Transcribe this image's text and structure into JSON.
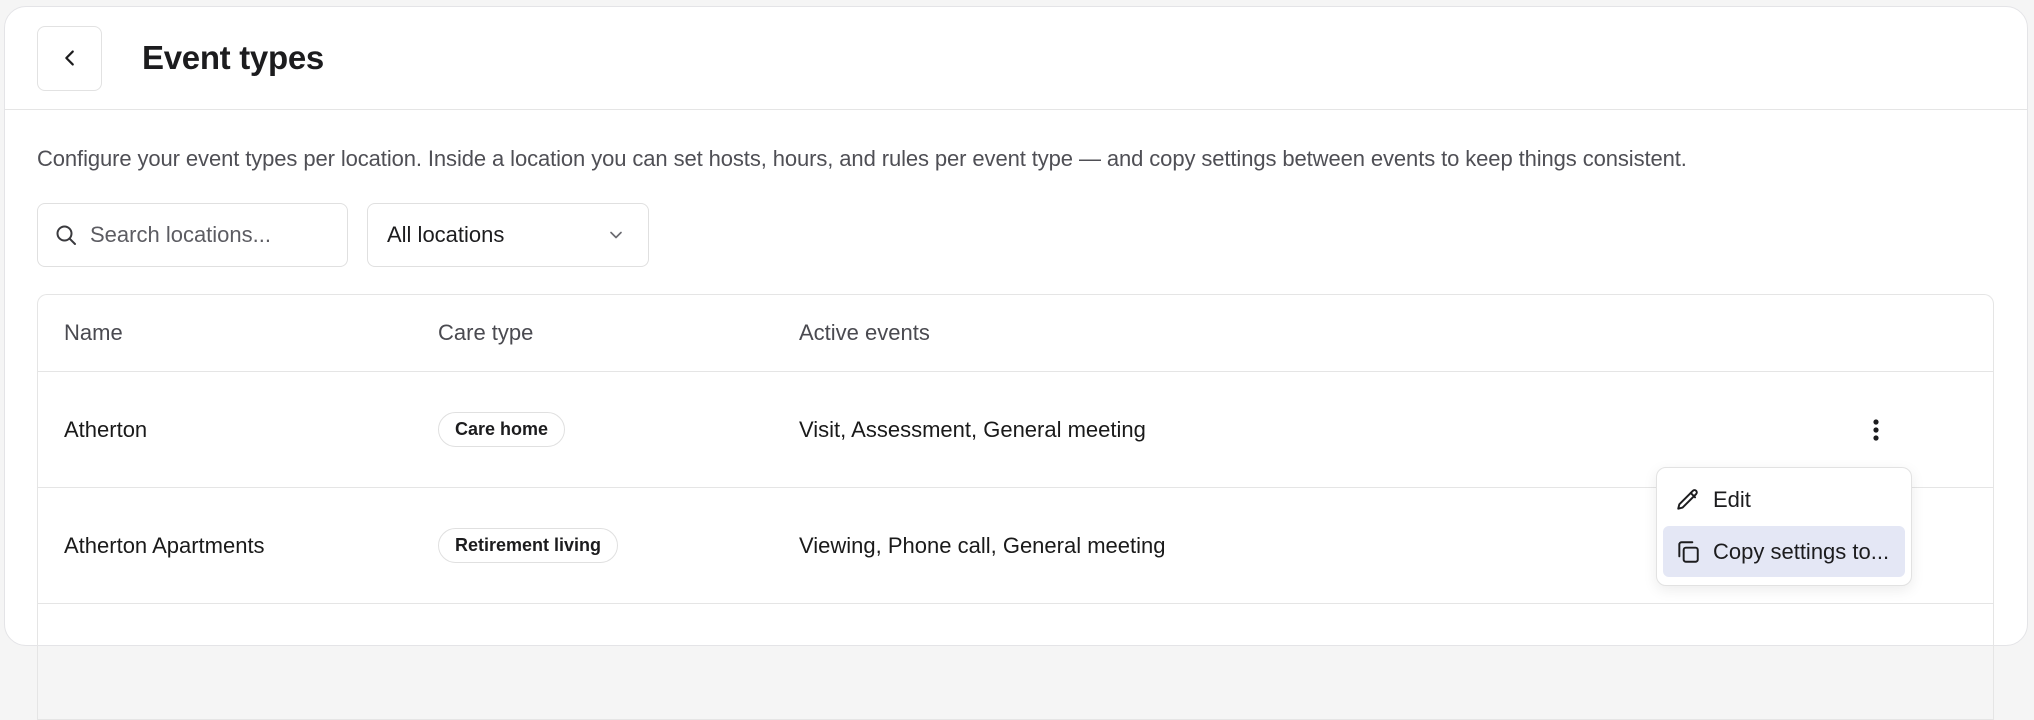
{
  "header": {
    "title": "Event types",
    "back_icon": "chevron-left-icon"
  },
  "description": "Configure your event types per location. Inside a location you can set hosts, hours, and rules per event type — and copy settings between events to keep things consistent.",
  "filters": {
    "search_placeholder": "Search locations...",
    "search_value": "",
    "location_select": "All locations"
  },
  "table": {
    "columns": [
      "Name",
      "Care type",
      "Active events"
    ],
    "rows": [
      {
        "name": "Atherton",
        "care_type": "Care home",
        "events": "Visit, Assessment, General meeting"
      },
      {
        "name": "Atherton Apartments",
        "care_type": "Retirement living",
        "events": "Viewing, Phone call, General meeting"
      }
    ]
  },
  "row_menu": {
    "items": [
      {
        "label": "Edit",
        "icon": "pencil-icon"
      },
      {
        "label": "Copy settings to...",
        "icon": "copy-icon"
      }
    ]
  },
  "colors": {
    "menu_highlight": "#e4e7f5",
    "border": "#e5e5e5"
  }
}
